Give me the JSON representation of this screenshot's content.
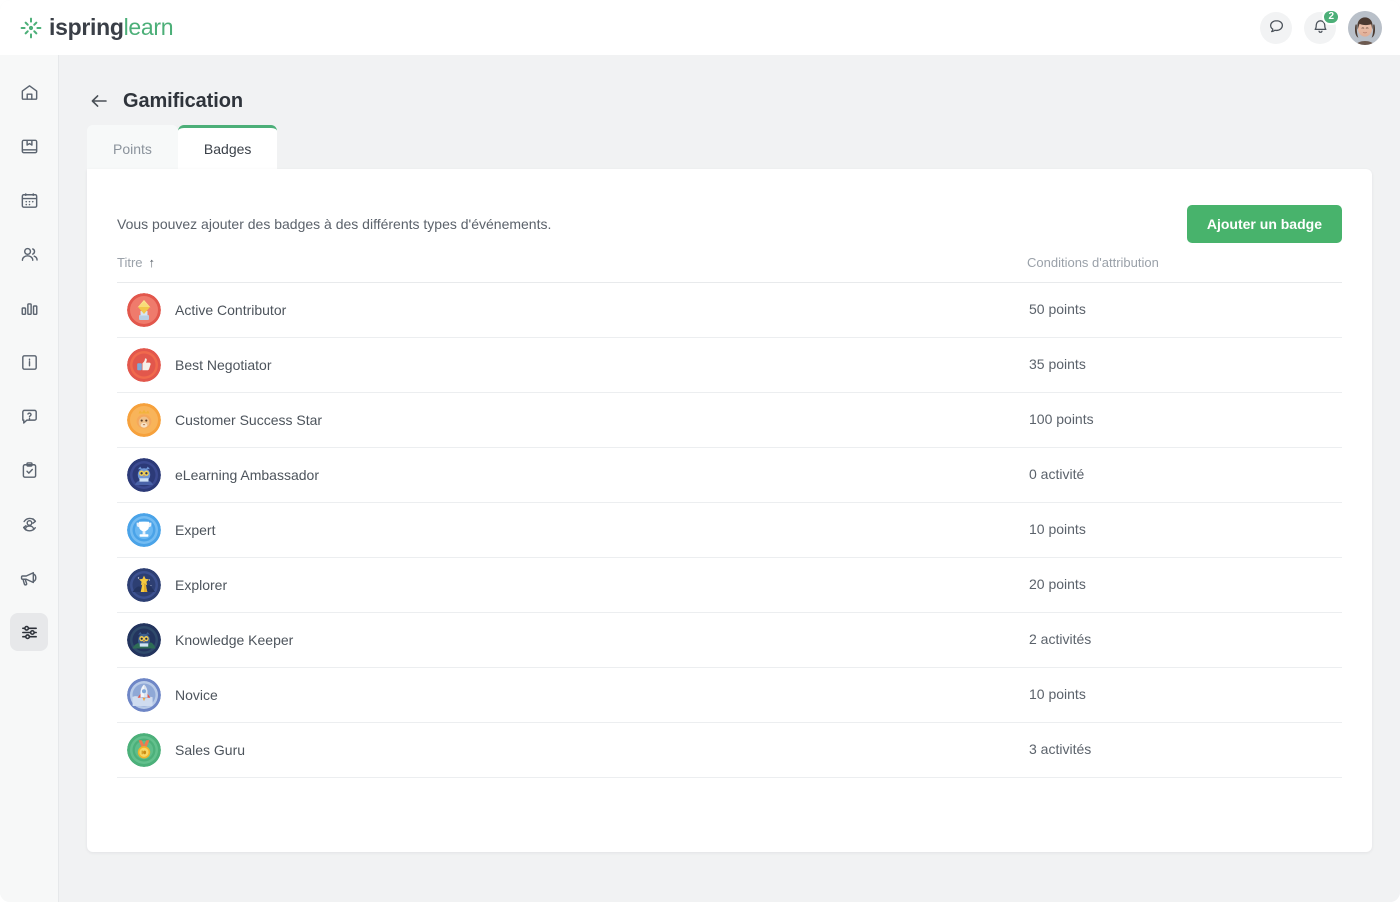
{
  "brand": {
    "name_bold": "ispring",
    "name_light": "learn",
    "logo_icon": "ispring-sunburst-icon"
  },
  "topbar": {
    "chat_icon": "chat-bubble-icon",
    "notifications_icon": "bell-icon",
    "notifications_count": "2",
    "avatar_alt": "user-avatar"
  },
  "sidebar": {
    "items": [
      {
        "name": "home",
        "icon": "home-icon",
        "active": false
      },
      {
        "name": "courses",
        "icon": "book-icon",
        "active": false
      },
      {
        "name": "calendar",
        "icon": "calendar-icon",
        "active": false
      },
      {
        "name": "users",
        "icon": "users-icon",
        "active": false
      },
      {
        "name": "reports",
        "icon": "bar-chart-icon",
        "active": false
      },
      {
        "name": "news",
        "icon": "info-box-icon",
        "active": false
      },
      {
        "name": "help",
        "icon": "question-chat-icon",
        "active": false
      },
      {
        "name": "tasks",
        "icon": "clipboard-check-icon",
        "active": false
      },
      {
        "name": "onboarding",
        "icon": "user-sync-icon",
        "active": false
      },
      {
        "name": "announcements",
        "icon": "megaphone-icon",
        "active": false
      },
      {
        "name": "settings",
        "icon": "sliders-icon",
        "active": true
      }
    ]
  },
  "page": {
    "back_icon": "arrow-left-icon",
    "title": "Gamification",
    "tabs": [
      {
        "label": "Points",
        "active": false
      },
      {
        "label": "Badges",
        "active": true
      }
    ],
    "intro": "Vous pouvez ajouter des badges à des différents types d'événements.",
    "add_badge_label": "Ajouter un badge"
  },
  "table": {
    "columns": {
      "title": "Titre",
      "title_sort": "↑",
      "condition": "Conditions d'attribution"
    },
    "rows": [
      {
        "title": "Active Contributor",
        "condition": "50 points",
        "icon": "badge-gem-icon",
        "ring": "#e2574c",
        "inner": "#ef7b6c"
      },
      {
        "title": "Best Negotiator",
        "condition": "35 points",
        "icon": "badge-thumbsup-icon",
        "ring": "#e2574c",
        "inner": "#f06a4d"
      },
      {
        "title": "Customer Success Star",
        "condition": "100 points",
        "icon": "badge-lion-icon",
        "ring": "#f6a13c",
        "inner": "#f8b45a"
      },
      {
        "title": "eLearning Ambassador",
        "condition": "0 activité",
        "icon": "badge-owl-icon",
        "ring": "#2c3a78",
        "inner": "#3b4a91"
      },
      {
        "title": "Expert",
        "condition": "10 points",
        "icon": "badge-trophy-icon",
        "ring": "#4aa3e8",
        "inner": "#74bcf2"
      },
      {
        "title": "Explorer",
        "condition": "20 points",
        "icon": "badge-star-icon",
        "ring": "#2d3f73",
        "inner": "#3c5190"
      },
      {
        "title": "Knowledge Keeper",
        "condition": "2 activités",
        "icon": "badge-owl2-icon",
        "ring": "#23345e",
        "inner": "#2f4a6b"
      },
      {
        "title": "Novice",
        "condition": "10 points",
        "icon": "badge-rocket-icon",
        "ring": "#6e86c6",
        "inner": "#b9cbe8"
      },
      {
        "title": "Sales Guru",
        "condition": "3 activités",
        "icon": "badge-medal-icon",
        "ring": "#4cb07a",
        "inner": "#63c08d"
      }
    ]
  },
  "colors": {
    "accent_green": "#48b36c",
    "page_bg": "#f1f2f3",
    "card_bg": "#ffffff"
  }
}
